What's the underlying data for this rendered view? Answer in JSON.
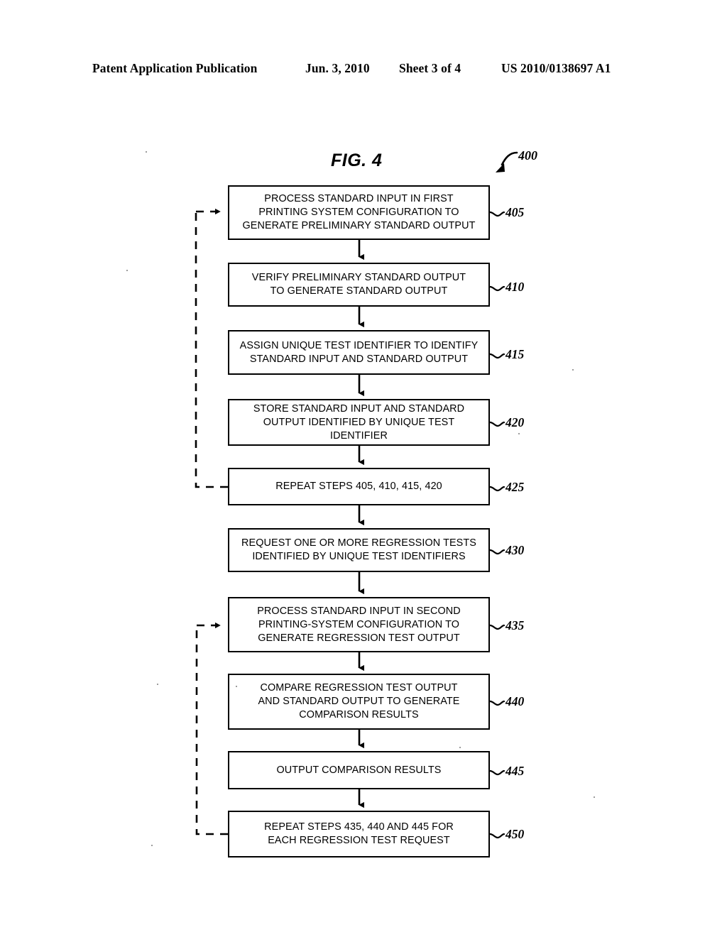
{
  "header": {
    "publication": "Patent Application Publication",
    "date": "Jun. 3, 2010",
    "sheet": "Sheet 3 of 4",
    "patent_number": "US 2010/0138697 A1"
  },
  "figure": {
    "title": "FIG. 4",
    "diagram_reference": "400",
    "type": "flowchart",
    "boxes": [
      {
        "ref": "405",
        "text": "PROCESS STANDARD INPUT IN FIRST\nPRINTING SYSTEM CONFIGURATION TO\nGENERATE PRELIMINARY STANDARD OUTPUT"
      },
      {
        "ref": "410",
        "text": "VERIFY PRELIMINARY STANDARD OUTPUT\nTO GENERATE STANDARD OUTPUT"
      },
      {
        "ref": "415",
        "text": "ASSIGN UNIQUE TEST IDENTIFIER TO IDENTIFY\nSTANDARD INPUT AND STANDARD OUTPUT"
      },
      {
        "ref": "420",
        "text": "STORE STANDARD INPUT AND STANDARD\nOUTPUT IDENTIFIED BY UNIQUE TEST IDENTIFIER"
      },
      {
        "ref": "425",
        "text": "REPEAT STEPS 405, 410, 415, 420"
      },
      {
        "ref": "430",
        "text": "REQUEST ONE OR MORE REGRESSION TESTS\nIDENTIFIED BY UNIQUE TEST IDENTIFIERS"
      },
      {
        "ref": "435",
        "text": "PROCESS STANDARD INPUT IN SECOND\nPRINTING-SYSTEM CONFIGURATION TO\nGENERATE REGRESSION TEST OUTPUT"
      },
      {
        "ref": "440",
        "text": "COMPARE REGRESSION TEST OUTPUT\nAND STANDARD OUTPUT TO GENERATE\nCOMPARISON RESULTS"
      },
      {
        "ref": "445",
        "text": "OUTPUT COMPARISON RESULTS"
      },
      {
        "ref": "450",
        "text": "REPEAT STEPS 435, 440 AND 445 FOR\nEACH REGRESSION TEST REQUEST"
      }
    ],
    "feedback_loops": [
      {
        "from_ref": "425",
        "to_ref": "405",
        "style": "dashed"
      },
      {
        "from_ref": "450",
        "to_ref": "435",
        "style": "dashed"
      }
    ],
    "colors": {
      "ink": "#000000",
      "paper": "#ffffff"
    }
  }
}
